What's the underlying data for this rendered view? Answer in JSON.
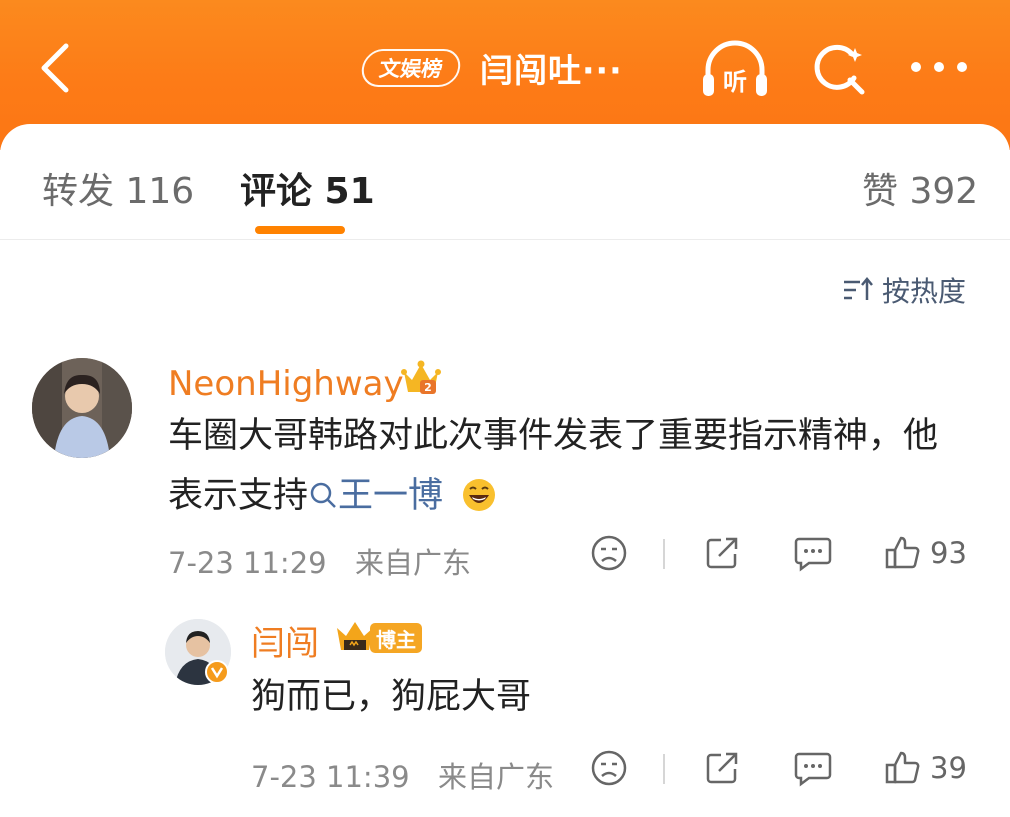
{
  "header": {
    "badge": "文娱榜",
    "title": "闫闯吐···",
    "listen_label": "听"
  },
  "tabs": {
    "repost": "转发 116",
    "comment": "评论 51",
    "like": "赞 392"
  },
  "sort": {
    "label": "按热度"
  },
  "comments": [
    {
      "username": "NeonHighway",
      "text_before_topic": "车圈大哥韩路对此次事件发表了重要指示精神，他表示支持",
      "topic": "王一博",
      "time": "7-23 11:29",
      "location": "来自广东",
      "likes": "93"
    }
  ],
  "reply": {
    "username": "闫闯",
    "owner_tag": "博主",
    "text": "狗而已，狗屁大哥",
    "time": "7-23 11:39",
    "location": "来自广东",
    "likes": "39"
  },
  "colors": {
    "header": "#fc7b17",
    "accent": "#ff8200",
    "username": "#ef7d22",
    "topic": "#4a6da0"
  }
}
